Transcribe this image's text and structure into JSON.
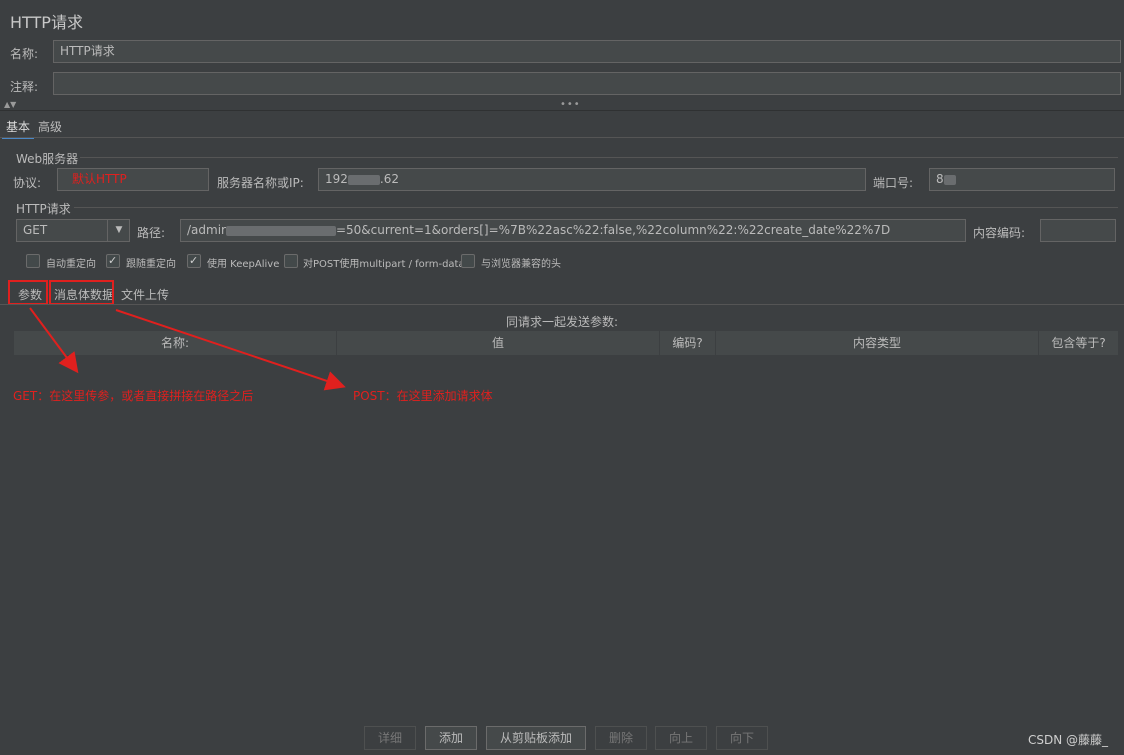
{
  "window": {
    "title": "HTTP请求"
  },
  "form": {
    "name_label": "名称:",
    "name_value": "HTTP请求",
    "comment_label": "注释:",
    "comment_value": ""
  },
  "tabs": {
    "basic": "基本",
    "advanced": "高级"
  },
  "web_server": {
    "section": "Web服务器",
    "protocol_label": "协议:",
    "protocol_value": "默认HTTP",
    "server_label": "服务器名称或IP:",
    "server_prefix": "192",
    "server_suffix": ".62",
    "port_label": "端口号:",
    "port_value": "8"
  },
  "http_request": {
    "section": "HTTP请求",
    "method": "GET",
    "path_label": "路径:",
    "path_prefix": "/admir",
    "path_suffix": "=50&current=1&orders[]=%7B%22asc%22:false,%22column%22:%22create_date%22%7D",
    "encoding_label": "内容编码:",
    "encoding_value": ""
  },
  "options": {
    "redirect_auto": {
      "label": "自动重定向",
      "checked": false
    },
    "follow_redirect": {
      "label": "跟随重定向",
      "checked": true
    },
    "keepalive": {
      "label": "使用 KeepAlive",
      "checked": true
    },
    "multipart": {
      "label": "对POST使用multipart / form-data",
      "checked": false
    },
    "browser_headers": {
      "label": "与浏览器兼容的头",
      "checked": false
    }
  },
  "subtabs": {
    "params": "参数",
    "body": "消息体数据",
    "files": "文件上传"
  },
  "params_table": {
    "caption": "同请求一起发送参数:",
    "headers": [
      "名称:",
      "值",
      "编码?",
      "内容类型",
      "包含等于?"
    ]
  },
  "annotations": {
    "get_note": "GET：在这里传参，或者直接拼接在路径之后",
    "post_note": "POST：在这里添加请求体"
  },
  "buttons": {
    "detail": "详细",
    "add": "添加",
    "add_clipboard": "从剪贴板添加",
    "delete": "删除",
    "up": "向上",
    "down": "向下"
  },
  "watermark": "CSDN @藤藤_",
  "colors": {
    "background": "#3c3f41",
    "field": "#45494a",
    "annotation": "#e0201e",
    "accent": "#4a88c7"
  }
}
